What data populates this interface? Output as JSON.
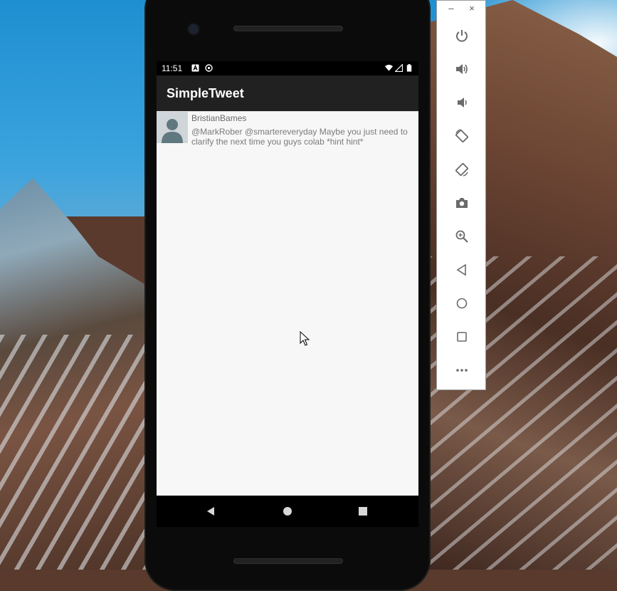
{
  "statusbar": {
    "time": "11:51",
    "icons": [
      "a-icon",
      "sync-icon",
      "wifi-icon",
      "cell-signal-icon",
      "battery-icon"
    ]
  },
  "app": {
    "title": "SimpleTweet"
  },
  "tweets": [
    {
      "username": "BristianBames",
      "body": "@MarkRober @smartereveryday Maybe you just need to clarify the next time you guys colab *hint hint*"
    }
  ],
  "navbar": {
    "buttons": [
      "back-icon",
      "home-icon",
      "recents-icon"
    ]
  },
  "emulator_panel": {
    "window_controls": {
      "minimize": "–",
      "close": "×"
    },
    "buttons": [
      "power-icon",
      "volume-up-icon",
      "volume-down-icon",
      "rotate-left-icon",
      "rotate-right-icon",
      "camera-icon",
      "zoom-icon",
      "back-icon",
      "home-icon",
      "overview-icon",
      "more-icon"
    ]
  },
  "colors": {
    "toolbar": "#212121",
    "content_bg": "#f7f7f7",
    "avatar_bg": "#cfd5d8",
    "avatar_fg": "#607880",
    "panel_icon": "#6a6a6a"
  }
}
